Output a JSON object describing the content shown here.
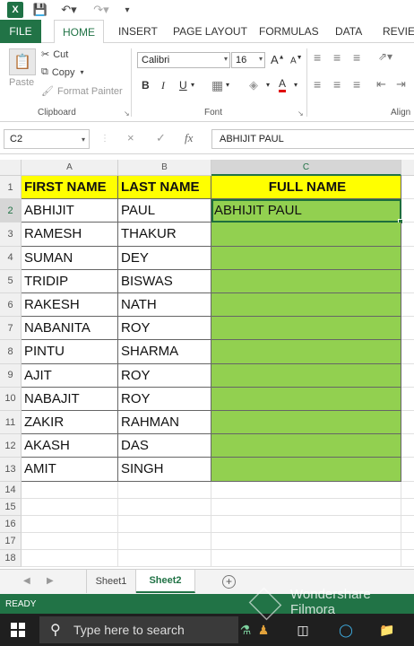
{
  "ribbon": {
    "tabs": [
      "FILE",
      "HOME",
      "INSERT",
      "PAGE LAYOUT",
      "FORMULAS",
      "DATA",
      "REVIEW"
    ],
    "clipboard": {
      "paste": "Paste",
      "cut": "Cut",
      "copy": "Copy",
      "format_painter": "Format Painter",
      "group_label": "Clipboard"
    },
    "font": {
      "name": "Calibri",
      "size": "16",
      "grow": "A",
      "shrink": "A",
      "bold": "B",
      "italic": "I",
      "underline": "U",
      "font_color": "A",
      "group_label": "Font"
    },
    "alignment_label": "Align"
  },
  "formula_bar": {
    "name_box": "C2",
    "cancel": "×",
    "enter": "✓",
    "fx": "fx",
    "value": "ABHIJIT PAUL"
  },
  "sheet": {
    "columns": [
      "A",
      "B",
      "C"
    ],
    "rows": [
      "1",
      "2",
      "3",
      "4",
      "5",
      "6",
      "7",
      "8",
      "9",
      "10",
      "11",
      "12",
      "13",
      "14",
      "15",
      "16",
      "17",
      "18"
    ],
    "headers": [
      "FIRST NAME",
      "LAST NAME",
      "FULL NAME"
    ],
    "data": [
      [
        "ABHIJIT",
        "PAUL",
        "ABHIJIT PAUL"
      ],
      [
        "RAMESH",
        "THAKUR",
        ""
      ],
      [
        "SUMAN",
        "DEY",
        ""
      ],
      [
        "TRIDIP",
        "BISWAS",
        ""
      ],
      [
        "RAKESH",
        "NATH",
        ""
      ],
      [
        "NABANITA",
        "ROY",
        ""
      ],
      [
        "PINTU",
        "SHARMA",
        ""
      ],
      [
        "AJIT",
        "ROY",
        ""
      ],
      [
        "NABAJIT",
        "ROY",
        ""
      ],
      [
        "ZAKIR",
        "RAHMAN",
        ""
      ],
      [
        "AKASH",
        "DAS",
        ""
      ],
      [
        "AMIT",
        "SINGH",
        ""
      ]
    ],
    "tabs": [
      "Sheet1",
      "Sheet2"
    ]
  },
  "status": {
    "text": "READY"
  },
  "taskbar": {
    "search_placeholder": "Type here to search"
  },
  "watermark": {
    "line1": "Wondershare",
    "line2": "Filmora"
  },
  "colors": {
    "excel_green": "#217346",
    "header_fill": "#ffff00",
    "full_name_fill": "#92d050"
  }
}
